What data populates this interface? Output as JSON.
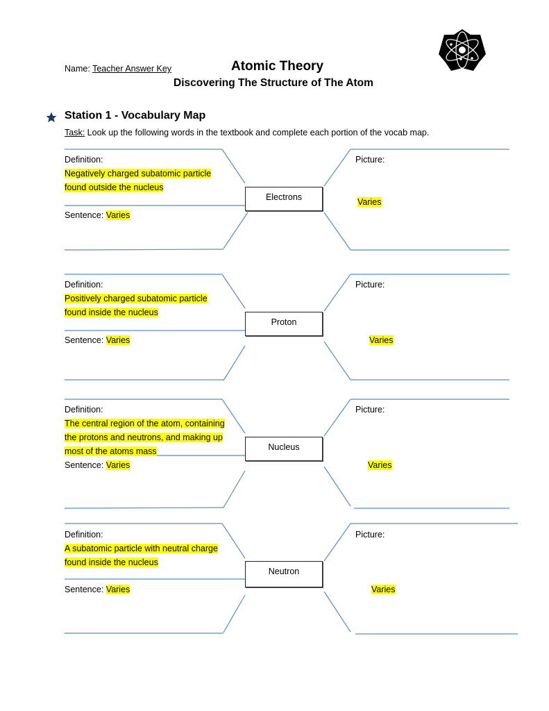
{
  "header": {
    "name_label": "Name:",
    "name_value": "Teacher Answer Key",
    "title": "Atomic Theory",
    "subtitle": "Discovering The Structure of The Atom",
    "logo_icon": "atom-icon"
  },
  "station": {
    "icon": "star-icon",
    "heading": "Station 1 - Vocabulary Map",
    "task_label": "Task:",
    "task_text": " Look up the following words in the textbook and complete each portion of the vocab map."
  },
  "labels": {
    "definition": "Definition:",
    "sentence": "Sentence:",
    "picture": "Picture:"
  },
  "colors": {
    "highlight": "#ffff00",
    "line": "#5b8cc9",
    "star": "#1f3a5f"
  },
  "maps": [
    {
      "term": "Electrons",
      "definition_lines": [
        "Negatively charged subatomic particle",
        "found outside the nucleus"
      ],
      "sentence": "Varies",
      "picture": "Varies"
    },
    {
      "term": "Proton",
      "definition_lines": [
        "Positively charged subatomic particle",
        "found inside the nucleus"
      ],
      "sentence": "Varies",
      "picture": "Varies"
    },
    {
      "term": "Nucleus",
      "definition_lines": [
        "The central region of the atom, containing",
        "the protons and neutrons, and making up",
        "most of the atoms mass"
      ],
      "sentence": "Varies",
      "picture": "Varies"
    },
    {
      "term": "Neutron",
      "definition_lines": [
        "A subatomic particle with neutral charge",
        "found inside the nucleus"
      ],
      "sentence": "Varies",
      "picture": "Varies"
    }
  ]
}
